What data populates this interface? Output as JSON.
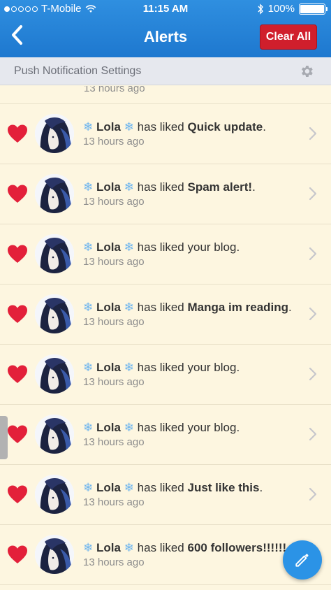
{
  "status_bar": {
    "carrier": "T-Mobile",
    "time": "11:15 AM",
    "battery": "100%",
    "signal_bars_filled": 1,
    "signal_bars_total": 5
  },
  "header": {
    "title": "Alerts",
    "clear_label": "Clear All",
    "back_icon": "chevron-left-icon"
  },
  "settings_bar": {
    "label": "Push Notification Settings",
    "icon": "gear-icon"
  },
  "partial_row": {
    "time": "13 hours ago"
  },
  "alerts": [
    {
      "user": "Lola",
      "action": "has liked",
      "target": "Quick update",
      "target_bold": true,
      "suffix": ".",
      "time": "13 hours ago"
    },
    {
      "user": "Lola",
      "action": "has liked",
      "target": "Spam alert!",
      "target_bold": true,
      "suffix": ".",
      "time": "13 hours ago"
    },
    {
      "user": "Lola",
      "action": "has liked",
      "target": "your blog",
      "target_bold": false,
      "suffix": ".",
      "time": "13 hours ago"
    },
    {
      "user": "Lola",
      "action": "has liked",
      "target": "Manga im reading",
      "target_bold": true,
      "suffix": ".",
      "time": "13 hours ago"
    },
    {
      "user": "Lola",
      "action": "has liked",
      "target": "your blog",
      "target_bold": false,
      "suffix": ".",
      "time": "13 hours ago"
    },
    {
      "user": "Lola",
      "action": "has liked",
      "target": "your blog",
      "target_bold": false,
      "suffix": ".",
      "time": "13 hours ago"
    },
    {
      "user": "Lola",
      "action": "has liked",
      "target": "Just like this",
      "target_bold": true,
      "suffix": ".",
      "time": "13 hours ago"
    },
    {
      "user": "Lola",
      "action": "has liked",
      "target": "600 followers!!!!!!",
      "target_bold": true,
      "suffix": ".",
      "time": "13 hours ago"
    }
  ],
  "colors": {
    "header_blue": "#1e78cf",
    "clear_red": "#d01f2c",
    "heart_red": "#e3203a",
    "background": "#fdf6e0",
    "fab_blue": "#2b93e6"
  },
  "fab": {
    "icon": "pencil-icon"
  }
}
